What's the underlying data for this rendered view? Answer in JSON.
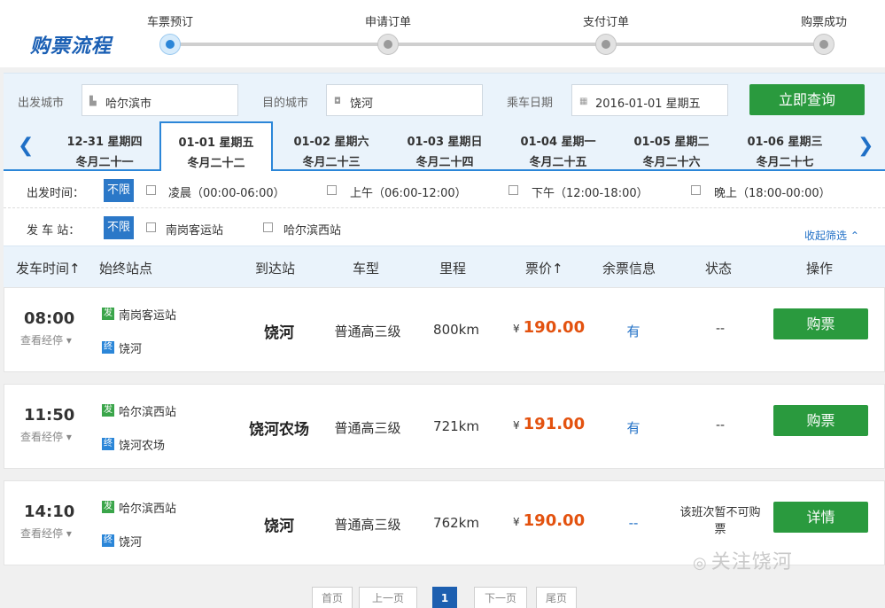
{
  "brand": "购票流程",
  "steps": [
    {
      "label": "车票预订",
      "active": true
    },
    {
      "label": "申请订单",
      "active": false
    },
    {
      "label": "支付订单",
      "active": false
    },
    {
      "label": "购票成功",
      "active": false
    }
  ],
  "search": {
    "from_label": "出发城市",
    "from_value": "哈尔滨市",
    "to_label": "目的城市",
    "to_value": "饶河",
    "date_label": "乘车日期",
    "date_value": "2016-01-01 星期五",
    "query_button": "立即查询"
  },
  "dates": [
    {
      "date": "12-31 星期四",
      "lunar": "冬月二十一",
      "active": false
    },
    {
      "date": "01-01 星期五",
      "lunar": "冬月二十二",
      "active": true
    },
    {
      "date": "01-02 星期六",
      "lunar": "冬月二十三",
      "active": false
    },
    {
      "date": "01-03 星期日",
      "lunar": "冬月二十四",
      "active": false
    },
    {
      "date": "01-04 星期一",
      "lunar": "冬月二十五",
      "active": false
    },
    {
      "date": "01-05 星期二",
      "lunar": "冬月二十六",
      "active": false
    },
    {
      "date": "01-06 星期三",
      "lunar": "冬月二十七",
      "active": false
    }
  ],
  "filters": {
    "depart_time_label": "出发时间：",
    "all_label": "不限",
    "time_options": [
      "凌晨（00:00-06:00）",
      "上午（06:00-12:00）",
      "下午（12:00-18:00）",
      "晚上（18:00-00:00）"
    ],
    "station_label": "发 车 站：",
    "station_all_label": "不限",
    "station_options": [
      "南岗客运站",
      "哈尔滨西站"
    ],
    "collapse_label": "收起筛选"
  },
  "table_headers": {
    "depart_time": "发车时间↑",
    "stations": "始终站点",
    "arrive": "到达站",
    "bus_type": "车型",
    "distance": "里程",
    "price": "票价↑",
    "tickets": "余票信息",
    "status": "状态",
    "action": "操作"
  },
  "labels": {
    "via": "查看经停",
    "from_badge": "发",
    "to_badge": "终",
    "yen": "¥"
  },
  "rows": [
    {
      "time": "08:00",
      "from_station": "南岗客运站",
      "to_station": "饶河",
      "arrive": "饶河",
      "bus_type": "普通高三级",
      "distance": "800km",
      "price": "190.00",
      "tickets": "有",
      "status": "--",
      "status_multi": false,
      "button": "购票"
    },
    {
      "time": "11:50",
      "from_station": "哈尔滨西站",
      "to_station": "饶河农场",
      "arrive": "饶河农场",
      "bus_type": "普通高三级",
      "distance": "721km",
      "price": "191.00",
      "tickets": "有",
      "status": "--",
      "status_multi": false,
      "button": "购票"
    },
    {
      "time": "14:10",
      "from_station": "哈尔滨西站",
      "to_station": "饶河",
      "arrive": "饶河",
      "bus_type": "普通高三级",
      "distance": "762km",
      "price": "190.00",
      "tickets": "--",
      "status": "该班次暂不可购票",
      "status_multi": true,
      "button": "详情"
    }
  ],
  "pager": {
    "first": "首页",
    "prev": "上一页",
    "current": "1",
    "next": "下一页",
    "last": "尾页"
  },
  "watermark": "关注饶河"
}
